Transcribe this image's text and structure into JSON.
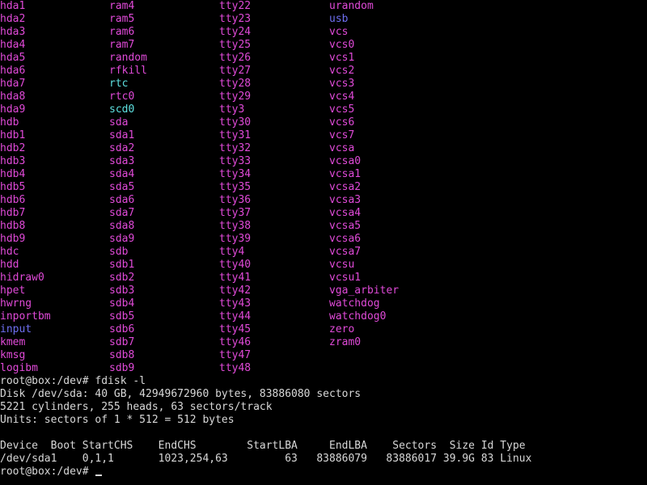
{
  "colors": {
    "background": "#000000",
    "text": "#d8d8d8",
    "device": "#e04ad8",
    "directory": "#6f6ff2",
    "symlink": "#5ee0e0"
  },
  "listing": {
    "columns": [
      [
        {
          "name": "hda1",
          "kind": "device"
        },
        {
          "name": "hda2",
          "kind": "device"
        },
        {
          "name": "hda3",
          "kind": "device"
        },
        {
          "name": "hda4",
          "kind": "device"
        },
        {
          "name": "hda5",
          "kind": "device"
        },
        {
          "name": "hda6",
          "kind": "device"
        },
        {
          "name": "hda7",
          "kind": "device"
        },
        {
          "name": "hda8",
          "kind": "device"
        },
        {
          "name": "hda9",
          "kind": "device"
        },
        {
          "name": "hdb",
          "kind": "device"
        },
        {
          "name": "hdb1",
          "kind": "device"
        },
        {
          "name": "hdb2",
          "kind": "device"
        },
        {
          "name": "hdb3",
          "kind": "device"
        },
        {
          "name": "hdb4",
          "kind": "device"
        },
        {
          "name": "hdb5",
          "kind": "device"
        },
        {
          "name": "hdb6",
          "kind": "device"
        },
        {
          "name": "hdb7",
          "kind": "device"
        },
        {
          "name": "hdb8",
          "kind": "device"
        },
        {
          "name": "hdb9",
          "kind": "device"
        },
        {
          "name": "hdc",
          "kind": "device"
        },
        {
          "name": "hdd",
          "kind": "device"
        },
        {
          "name": "hidraw0",
          "kind": "device"
        },
        {
          "name": "hpet",
          "kind": "device"
        },
        {
          "name": "hwrng",
          "kind": "device"
        },
        {
          "name": "inportbm",
          "kind": "device"
        },
        {
          "name": "input",
          "kind": "dir"
        },
        {
          "name": "kmem",
          "kind": "device"
        },
        {
          "name": "kmsg",
          "kind": "device"
        },
        {
          "name": "logibm",
          "kind": "device"
        }
      ],
      [
        {
          "name": "ram4",
          "kind": "device"
        },
        {
          "name": "ram5",
          "kind": "device"
        },
        {
          "name": "ram6",
          "kind": "device"
        },
        {
          "name": "ram7",
          "kind": "device"
        },
        {
          "name": "random",
          "kind": "device"
        },
        {
          "name": "rfkill",
          "kind": "device"
        },
        {
          "name": "rtc",
          "kind": "link"
        },
        {
          "name": "rtc0",
          "kind": "device"
        },
        {
          "name": "scd0",
          "kind": "link"
        },
        {
          "name": "sda",
          "kind": "device"
        },
        {
          "name": "sda1",
          "kind": "device"
        },
        {
          "name": "sda2",
          "kind": "device"
        },
        {
          "name": "sda3",
          "kind": "device"
        },
        {
          "name": "sda4",
          "kind": "device"
        },
        {
          "name": "sda5",
          "kind": "device"
        },
        {
          "name": "sda6",
          "kind": "device"
        },
        {
          "name": "sda7",
          "kind": "device"
        },
        {
          "name": "sda8",
          "kind": "device"
        },
        {
          "name": "sda9",
          "kind": "device"
        },
        {
          "name": "sdb",
          "kind": "device"
        },
        {
          "name": "sdb1",
          "kind": "device"
        },
        {
          "name": "sdb2",
          "kind": "device"
        },
        {
          "name": "sdb3",
          "kind": "device"
        },
        {
          "name": "sdb4",
          "kind": "device"
        },
        {
          "name": "sdb5",
          "kind": "device"
        },
        {
          "name": "sdb6",
          "kind": "device"
        },
        {
          "name": "sdb7",
          "kind": "device"
        },
        {
          "name": "sdb8",
          "kind": "device"
        },
        {
          "name": "sdb9",
          "kind": "device"
        }
      ],
      [
        {
          "name": "tty22",
          "kind": "device"
        },
        {
          "name": "tty23",
          "kind": "device"
        },
        {
          "name": "tty24",
          "kind": "device"
        },
        {
          "name": "tty25",
          "kind": "device"
        },
        {
          "name": "tty26",
          "kind": "device"
        },
        {
          "name": "tty27",
          "kind": "device"
        },
        {
          "name": "tty28",
          "kind": "device"
        },
        {
          "name": "tty29",
          "kind": "device"
        },
        {
          "name": "tty3",
          "kind": "device"
        },
        {
          "name": "tty30",
          "kind": "device"
        },
        {
          "name": "tty31",
          "kind": "device"
        },
        {
          "name": "tty32",
          "kind": "device"
        },
        {
          "name": "tty33",
          "kind": "device"
        },
        {
          "name": "tty34",
          "kind": "device"
        },
        {
          "name": "tty35",
          "kind": "device"
        },
        {
          "name": "tty36",
          "kind": "device"
        },
        {
          "name": "tty37",
          "kind": "device"
        },
        {
          "name": "tty38",
          "kind": "device"
        },
        {
          "name": "tty39",
          "kind": "device"
        },
        {
          "name": "tty4",
          "kind": "device"
        },
        {
          "name": "tty40",
          "kind": "device"
        },
        {
          "name": "tty41",
          "kind": "device"
        },
        {
          "name": "tty42",
          "kind": "device"
        },
        {
          "name": "tty43",
          "kind": "device"
        },
        {
          "name": "tty44",
          "kind": "device"
        },
        {
          "name": "tty45",
          "kind": "device"
        },
        {
          "name": "tty46",
          "kind": "device"
        },
        {
          "name": "tty47",
          "kind": "device"
        },
        {
          "name": "tty48",
          "kind": "device"
        }
      ],
      [
        {
          "name": "urandom",
          "kind": "device"
        },
        {
          "name": "usb",
          "kind": "dir"
        },
        {
          "name": "vcs",
          "kind": "device"
        },
        {
          "name": "vcs0",
          "kind": "device"
        },
        {
          "name": "vcs1",
          "kind": "device"
        },
        {
          "name": "vcs2",
          "kind": "device"
        },
        {
          "name": "vcs3",
          "kind": "device"
        },
        {
          "name": "vcs4",
          "kind": "device"
        },
        {
          "name": "vcs5",
          "kind": "device"
        },
        {
          "name": "vcs6",
          "kind": "device"
        },
        {
          "name": "vcs7",
          "kind": "device"
        },
        {
          "name": "vcsa",
          "kind": "device"
        },
        {
          "name": "vcsa0",
          "kind": "device"
        },
        {
          "name": "vcsa1",
          "kind": "device"
        },
        {
          "name": "vcsa2",
          "kind": "device"
        },
        {
          "name": "vcsa3",
          "kind": "device"
        },
        {
          "name": "vcsa4",
          "kind": "device"
        },
        {
          "name": "vcsa5",
          "kind": "device"
        },
        {
          "name": "vcsa6",
          "kind": "device"
        },
        {
          "name": "vcsa7",
          "kind": "device"
        },
        {
          "name": "vcsu",
          "kind": "device"
        },
        {
          "name": "vcsu1",
          "kind": "device"
        },
        {
          "name": "vga_arbiter",
          "kind": "device"
        },
        {
          "name": "watchdog",
          "kind": "device"
        },
        {
          "name": "watchdog0",
          "kind": "device"
        },
        {
          "name": "zero",
          "kind": "device"
        },
        {
          "name": "zram0",
          "kind": "device"
        }
      ]
    ]
  },
  "session": {
    "prompt": "root@box:/dev# ",
    "command": "fdisk -l",
    "output_lines": [
      "Disk /dev/sda: 40 GB, 42949672960 bytes, 83886080 sectors",
      "5221 cylinders, 255 heads, 63 sectors/track",
      "Units: sectors of 1 * 512 = 512 bytes",
      "",
      "Device  Boot StartCHS    EndCHS        StartLBA     EndLBA    Sectors  Size Id Type",
      "/dev/sda1    0,1,1       1023,254,63         63   83886079   83886017 39.9G 83 Linux"
    ],
    "final_prompt": "root@box:/dev# "
  }
}
